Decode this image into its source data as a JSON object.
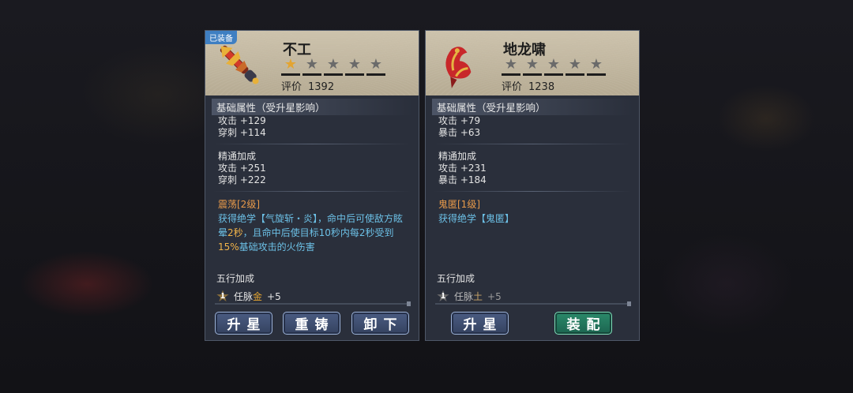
{
  "panels": {
    "left": {
      "equipped_tag": "已装备",
      "name": "不工",
      "stars_lit": 1,
      "stars_total": 5,
      "rating_label": "评价",
      "rating_value": "1392",
      "base_header": "基础属性（受升星影响）",
      "base_stats": [
        "攻击 +129",
        "穿刺 +114"
      ],
      "mastery_title": "精通加成",
      "mastery_stats": [
        "攻击 +251",
        "穿刺 +222"
      ],
      "skill_name": "震荡[2级]",
      "skill_desc_1": "获得绝学【气旋斩・炎】，命中后可使敌方眩晕",
      "skill_desc_hl1": "2秒",
      "skill_desc_2": "，且命中后使目标10秒内每2秒受到",
      "skill_desc_hl2": "15%",
      "skill_desc_3": "基础攻击的火伤害",
      "wx_title": "五行加成",
      "wx_badge": "1",
      "wx_label": "任脉",
      "wx_element": "金",
      "wx_value": "+5",
      "buttons": [
        "升星",
        "重铸",
        "卸下"
      ],
      "colors": {
        "weapon_primary": "#d23a2a",
        "weapon_accent": "#e8b13a"
      }
    },
    "right": {
      "name": "地龙啸",
      "stars_lit": 0,
      "stars_total": 5,
      "rating_label": "评价",
      "rating_value": "1238",
      "base_header": "基础属性（受升星影响）",
      "base_stats": [
        "攻击 +79",
        "暴击 +63"
      ],
      "mastery_title": "精通加成",
      "mastery_stats": [
        "攻击 +231",
        "暴击 +184"
      ],
      "skill_name": "鬼匿[1级]",
      "skill_desc": "获得绝学【鬼匿】",
      "wx_title": "五行加成",
      "wx_badge": "1",
      "wx_label": "任脉",
      "wx_element": "土",
      "wx_value": "+5",
      "buttons": [
        "升星",
        "装配"
      ],
      "colors": {
        "weapon_primary": "#c8272a",
        "weapon_accent": "#e5b542"
      }
    }
  }
}
